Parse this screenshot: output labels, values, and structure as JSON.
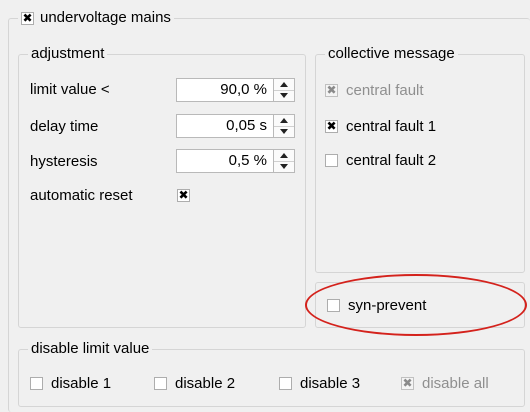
{
  "undervoltage": {
    "label": "undervoltage mains",
    "checked": true
  },
  "adjustment": {
    "title": "adjustment",
    "limit_value_label": "limit value <",
    "limit_value": "90,0 %",
    "delay_time_label": "delay time",
    "delay_time": "0,05 s",
    "hysteresis_label": "hysteresis",
    "hysteresis": "0,5 %",
    "automatic_reset_label": "automatic reset",
    "automatic_reset_checked": true
  },
  "collective_message": {
    "title": "collective message",
    "central_fault": {
      "label": "central fault",
      "checked": true,
      "enabled": false
    },
    "central_fault_1": {
      "label": "central fault 1",
      "checked": true,
      "enabled": true
    },
    "central_fault_2": {
      "label": "central fault 2",
      "checked": false,
      "enabled": true
    }
  },
  "syn_prevent": {
    "label": "syn-prevent",
    "checked": false
  },
  "disable_limit_value": {
    "title": "disable limit value",
    "disable_1": {
      "label": "disable 1",
      "checked": false
    },
    "disable_2": {
      "label": "disable 2",
      "checked": false
    },
    "disable_3": {
      "label": "disable 3",
      "checked": false
    },
    "disable_all": {
      "label": "disable all",
      "checked": true,
      "enabled": false
    }
  },
  "colors": {
    "highlight": "#d4221c",
    "background": "#f0f0f0",
    "disabled_text": "#8f8f8f"
  }
}
